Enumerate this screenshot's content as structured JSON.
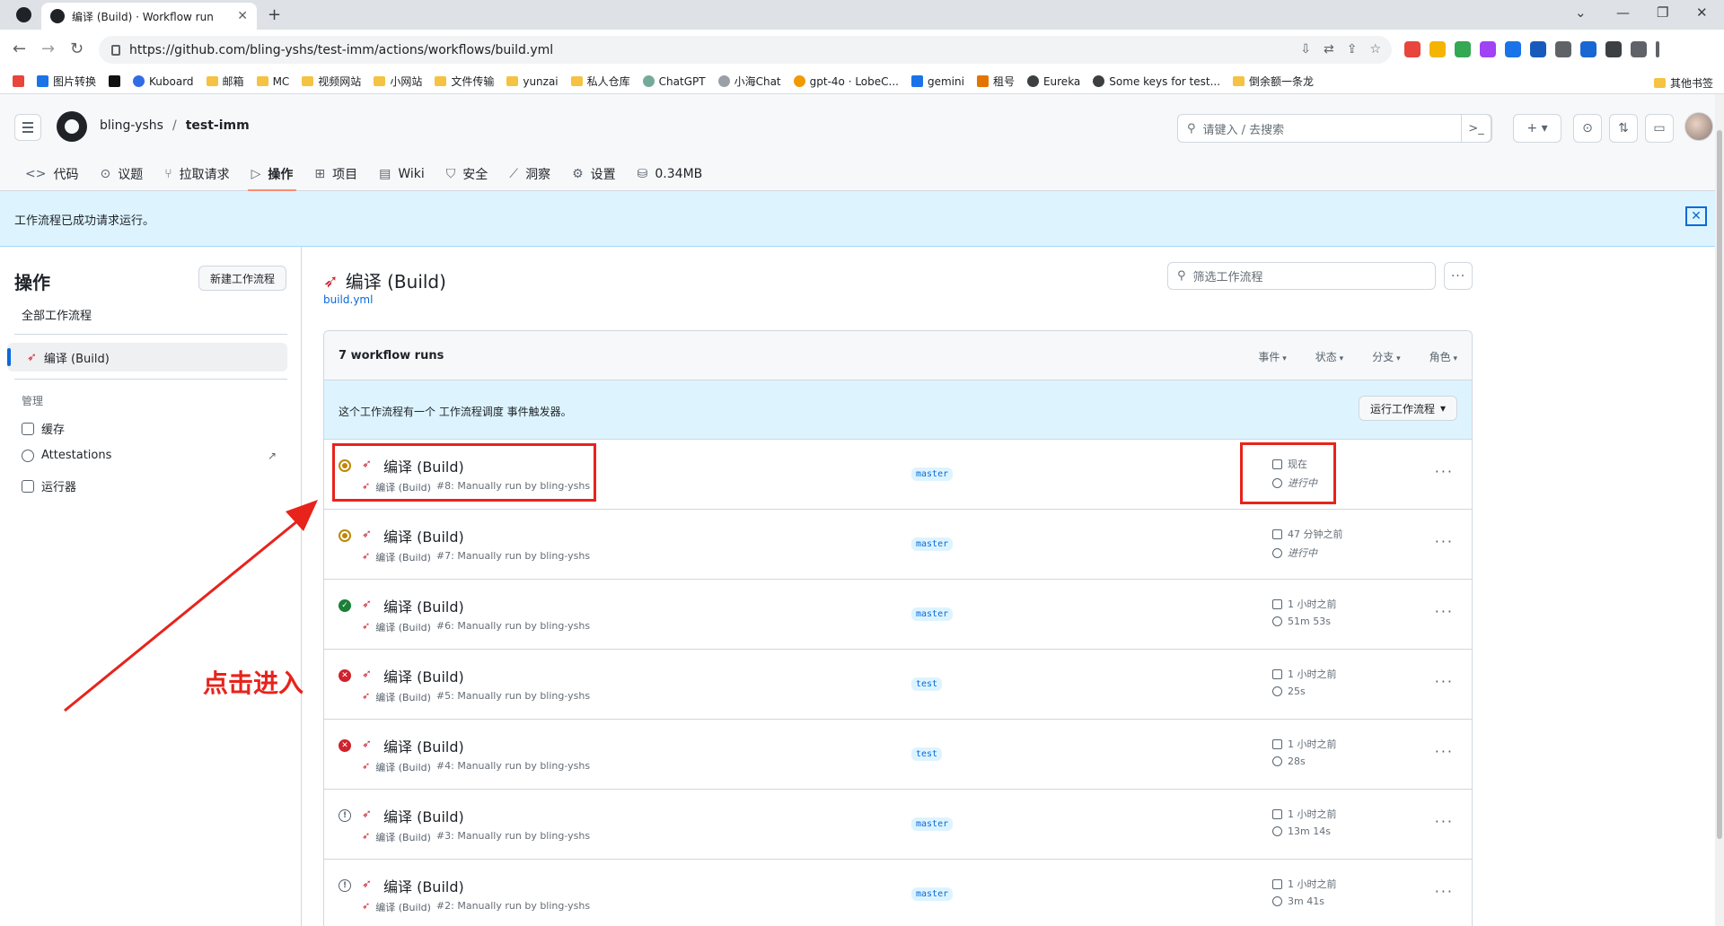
{
  "browser": {
    "tab_title": "编译 (Build) · Workflow run",
    "url": "https://github.com/bling-yshs/test-imm/actions/workflows/build.yml",
    "bookmarks": [
      "图片转换",
      "Kuboard",
      "邮箱",
      "MC",
      "视频网站",
      "小网站",
      "文件传输",
      "yunzai",
      "私人仓库",
      "ChatGPT",
      "小海Chat",
      "gpt-4o · LobeC...",
      "gemini",
      "租号",
      "Eureka",
      "Some keys for test...",
      "倒余额一条龙"
    ],
    "other_bookmarks": "其他书签"
  },
  "repo": {
    "owner": "bling-yshs",
    "separator": "/",
    "name": "test-imm",
    "search_placeholder": "请键入 / 去搜索",
    "tabs": [
      "代码",
      "议题",
      "拉取请求",
      "操作",
      "项目",
      "Wiki",
      "安全",
      "洞察",
      "设置",
      "0.34MB"
    ]
  },
  "flash": {
    "message": "工作流程已成功请求运行。"
  },
  "sidebar": {
    "title": "操作",
    "new_workflow": "新建工作流程",
    "all_workflows": "全部工作流程",
    "active_workflow": "编译 (Build)",
    "manage_label": "管理",
    "manage_items": [
      "缓存",
      "Attestations",
      "运行器"
    ]
  },
  "main": {
    "workflow_title": "编译 (Build)",
    "workflow_file": "build.yml",
    "filter_placeholder": "筛选工作流程",
    "runs_count": "7 workflow runs",
    "filters": [
      "事件",
      "状态",
      "分支",
      "角色"
    ],
    "schedule_text": "这个工作流程有一个  工作流程调度  事件触发器。",
    "run_workflow_button": "运行工作流程",
    "runs": [
      {
        "status": "queued",
        "name": "编译 (Build)",
        "workflow": "编译 (Build)",
        "detail": "#8: Manually run by bling-yshs",
        "branch": "master",
        "when": "现在",
        "duration": "进行中"
      },
      {
        "status": "queued",
        "name": "编译 (Build)",
        "workflow": "编译 (Build)",
        "detail": "#7: Manually run by bling-yshs",
        "branch": "master",
        "when": "47 分钟之前",
        "duration": "进行中"
      },
      {
        "status": "success",
        "name": "编译 (Build)",
        "workflow": "编译 (Build)",
        "detail": "#6: Manually run by bling-yshs",
        "branch": "master",
        "when": "1 小时之前",
        "duration": "51m 53s"
      },
      {
        "status": "failure",
        "name": "编译 (Build)",
        "workflow": "编译 (Build)",
        "detail": "#5: Manually run by bling-yshs",
        "branch": "test",
        "when": "1 小时之前",
        "duration": "25s"
      },
      {
        "status": "failure",
        "name": "编译 (Build)",
        "workflow": "编译 (Build)",
        "detail": "#4: Manually run by bling-yshs",
        "branch": "test",
        "when": "1 小时之前",
        "duration": "28s"
      },
      {
        "status": "cancel",
        "name": "编译 (Build)",
        "workflow": "编译 (Build)",
        "detail": "#3: Manually run by bling-yshs",
        "branch": "master",
        "when": "1 小时之前",
        "duration": "13m 14s"
      },
      {
        "status": "cancel",
        "name": "编译 (Build)",
        "workflow": "编译 (Build)",
        "detail": "#2: Manually run by bling-yshs",
        "branch": "master",
        "when": "1 小时之前",
        "duration": "3m 41s"
      }
    ]
  },
  "annotation": {
    "text": "点击进入",
    "color": "#e8231b"
  }
}
